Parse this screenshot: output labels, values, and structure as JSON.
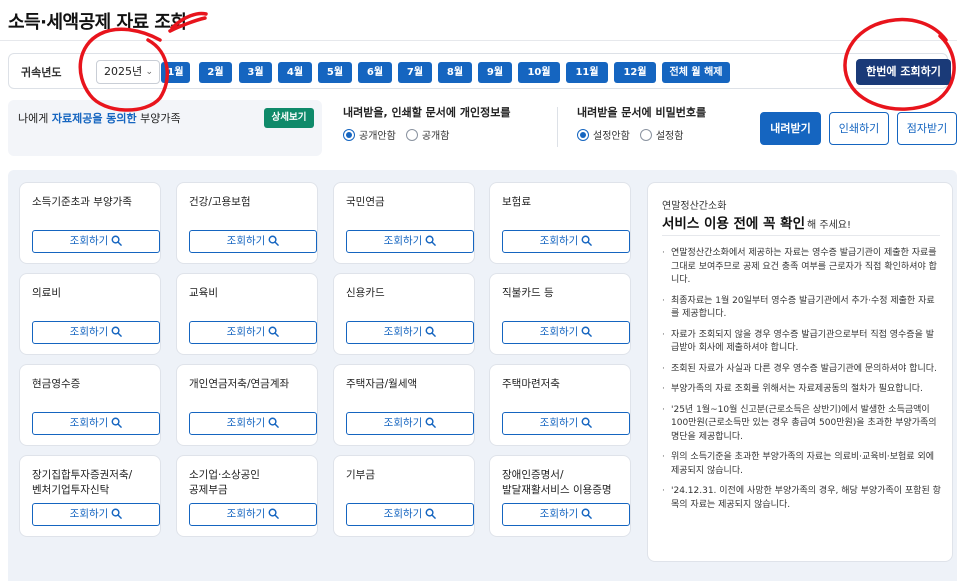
{
  "page": {
    "title": "소득·세액공제 자료 조회"
  },
  "filter": {
    "year_label": "귀속년도",
    "year_value": "2025년",
    "months": [
      "1월",
      "2월",
      "3월",
      "4월",
      "5월",
      "6월",
      "7월",
      "8월",
      "9월",
      "10월",
      "11월",
      "12월",
      "전체 월 해제"
    ],
    "query_all_label": "한번에 조회하기"
  },
  "consent": {
    "text_before": "나에게 ",
    "text_highlight": "자료제공을 동의한",
    "text_after": " 부양가족",
    "detail_label": "상세보기"
  },
  "personal_info": {
    "title": "내려받을, 인쇄할 문서에 개인정보를",
    "options": [
      "공개안함",
      "공개함"
    ],
    "selected": "공개안함"
  },
  "password": {
    "title": "내려받을 문서에 비밀번호를",
    "options": [
      "설정안함",
      "설정함"
    ],
    "selected": "설정안함"
  },
  "actions": {
    "download_label": "내려받기",
    "print_label": "인쇄하기",
    "braille_label": "점자받기"
  },
  "cards": [
    {
      "title": "소득기준초과 부양가족",
      "button": "조회하기"
    },
    {
      "title": "건강/고용보험",
      "button": "조회하기"
    },
    {
      "title": "국민연금",
      "button": "조회하기"
    },
    {
      "title": "보험료",
      "button": "조회하기"
    },
    {
      "title": "의료비",
      "button": "조회하기"
    },
    {
      "title": "교육비",
      "button": "조회하기"
    },
    {
      "title": "신용카드",
      "button": "조회하기"
    },
    {
      "title": "직불카드 등",
      "button": "조회하기"
    },
    {
      "title": "현금영수증",
      "button": "조회하기"
    },
    {
      "title": "개인연금저축/연금계좌",
      "button": "조회하기"
    },
    {
      "title": "주택자금/월세액",
      "button": "조회하기"
    },
    {
      "title": "주택마련저축",
      "button": "조회하기"
    },
    {
      "title": "장기집합투자증권저축/\n벤처기업투자신탁",
      "button": "조회하기"
    },
    {
      "title": "소기업·소상공인\n공제부금",
      "button": "조회하기"
    },
    {
      "title": "기부금",
      "button": "조회하기"
    },
    {
      "title": "장애인증명서/\n발달재활서비스 이용증명",
      "button": "조회하기"
    }
  ],
  "notice": {
    "subtitle": "연말정산간소화",
    "heading": "서비스 이용 전에 꼭 확인",
    "heading_tail": "해 주세요!",
    "items": [
      "연말정산간소화에서 제공하는 자료는 영수증 발급기관이 제출한 자료를 그대로 보여주므로 공제 요건 충족 여부를 근로자가 직접 확인하셔야 합니다.",
      "최종자료는 1월 20일부터 영수증 발급기관에서 추가·수정 제출한 자료를 제공합니다.",
      "자료가 조회되지 않을 경우 영수증 발급기관으로부터 직접 영수증을 발급받아 회사에 제출하셔야 합니다.",
      "조회된 자료가 사실과 다른 경우 영수증 발급기관에 문의하셔야 합니다.",
      "부양가족의 자료 조회를 위해서는 자료제공동의 절차가 필요합니다.",
      "'25년 1월~10월 신고분(근로소득은 상반기)에서 발생한 소득금액이 100만원(근로소득만 있는 경우 총급여 500만원)을 초과한 부양가족의 명단을 제공합니다.",
      "위의 소득기준을 초과한 부양가족의 자료는 의료비·교육비·보험료 외에 제공되지 않습니다.",
      "'24.12.31. 이전에 사망한 부양가족의 경우, 해당 부양가족이 포함된 항목의 자료는 제공되지 않습니다."
    ]
  },
  "colors": {
    "primary": "#1565c0",
    "navy": "#1a3a78",
    "green": "#0f8a6a",
    "annotation": "#e8141c"
  },
  "icons": {
    "card_button": "search-icon",
    "year_select": "chevron-down-icon"
  }
}
